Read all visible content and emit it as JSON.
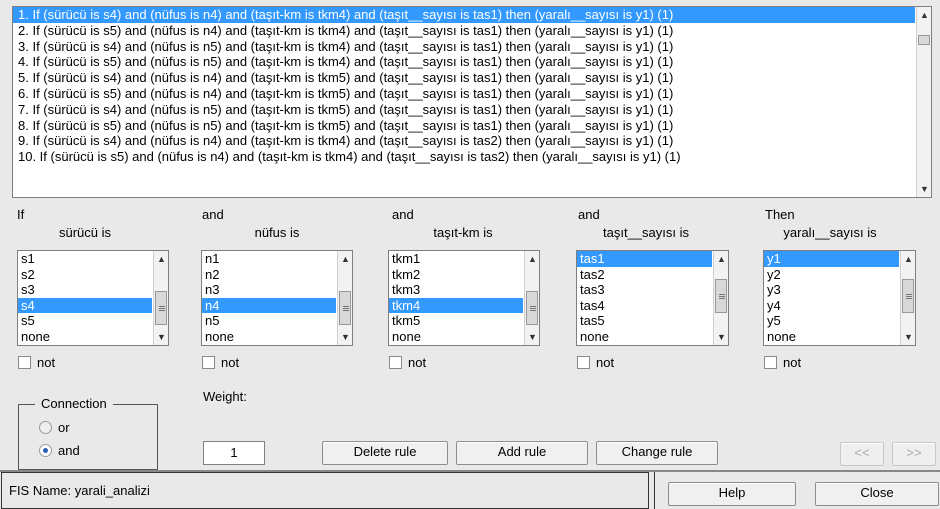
{
  "rules": [
    "1. If (sürücü is s4) and (nüfus is n4) and (taşıt-km is tkm4) and (taşıt__sayısı is tas1) then (yaralı__sayısı is y1) (1)",
    "2. If (sürücü is s5) and (nüfus is n4) and (taşıt-km is tkm4) and (taşıt__sayısı is tas1) then (yaralı__sayısı is y1) (1)",
    "3. If (sürücü is s4) and (nüfus is n5) and (taşıt-km is tkm4) and (taşıt__sayısı is tas1) then (yaralı__sayısı is y1) (1)",
    "4. If (sürücü is s5) and (nüfus is n5) and (taşıt-km is tkm4) and (taşıt__sayısı is tas1) then (yaralı__sayısı is y1) (1)",
    "5. If (sürücü is s4) and (nüfus is n4) and (taşıt-km is tkm5) and (taşıt__sayısı is tas1) then (yaralı__sayısı is y1) (1)",
    "6. If (sürücü is s5) and (nüfus is n4) and (taşıt-km is tkm5) and (taşıt__sayısı is tas1) then (yaralı__sayısı is y1) (1)",
    "7. If (sürücü is s4) and (nüfus is n5) and (taşıt-km is tkm5) and (taşıt__sayısı is tas1) then (yaralı__sayısı is y1) (1)",
    "8. If (sürücü is s5) and (nüfus is n5) and (taşıt-km is tkm5) and (taşıt__sayısı is tas1) then (yaralı__sayısı is y1) (1)",
    "9. If (sürücü is s4) and (nüfus is n4) and (taşıt-km is tkm4) and (taşıt__sayısı is tas2) then (yaralı__sayısı is y1) (1)",
    "10. If (sürücü is s5) and (nüfus is n4) and (taşıt-km is tkm4) and (taşıt__sayısı is tas2) then (yaralı__sayısı is y1) (1)"
  ],
  "columns": [
    {
      "prefix": "If",
      "title": "sürücü is",
      "items": [
        "s1",
        "s2",
        "s3",
        "s4",
        "s5",
        "none"
      ],
      "not_label": "not"
    },
    {
      "prefix": "and",
      "title": "nüfus is",
      "items": [
        "n1",
        "n2",
        "n3",
        "n4",
        "n5",
        "none"
      ],
      "not_label": "not"
    },
    {
      "prefix": "and",
      "title": "taşıt-km is",
      "items": [
        "tkm1",
        "tkm2",
        "tkm3",
        "tkm4",
        "tkm5",
        "none"
      ],
      "not_label": "not"
    },
    {
      "prefix": "and",
      "title": "taşıt__sayısı is",
      "items": [
        "tas1",
        "tas2",
        "tas3",
        "tas4",
        "tas5",
        "none"
      ],
      "not_label": "not"
    },
    {
      "prefix": "Then",
      "title": "yaralı__sayısı is",
      "items": [
        "y1",
        "y2",
        "y3",
        "y4",
        "y5",
        "none"
      ],
      "not_label": "not"
    }
  ],
  "connection": {
    "legend": "Connection",
    "or_label": "or",
    "and_label": "and"
  },
  "weight": {
    "label": "Weight:",
    "value": "1"
  },
  "buttons": {
    "delete": "Delete rule",
    "add": "Add rule",
    "change": "Change rule",
    "prev": "<<",
    "next": ">>",
    "help": "Help",
    "close": "Close"
  },
  "status": {
    "fis_name": "FIS Name: yarali_analizi"
  },
  "colors": {
    "selection": "#3399ff",
    "background": "#e9e9e9"
  }
}
